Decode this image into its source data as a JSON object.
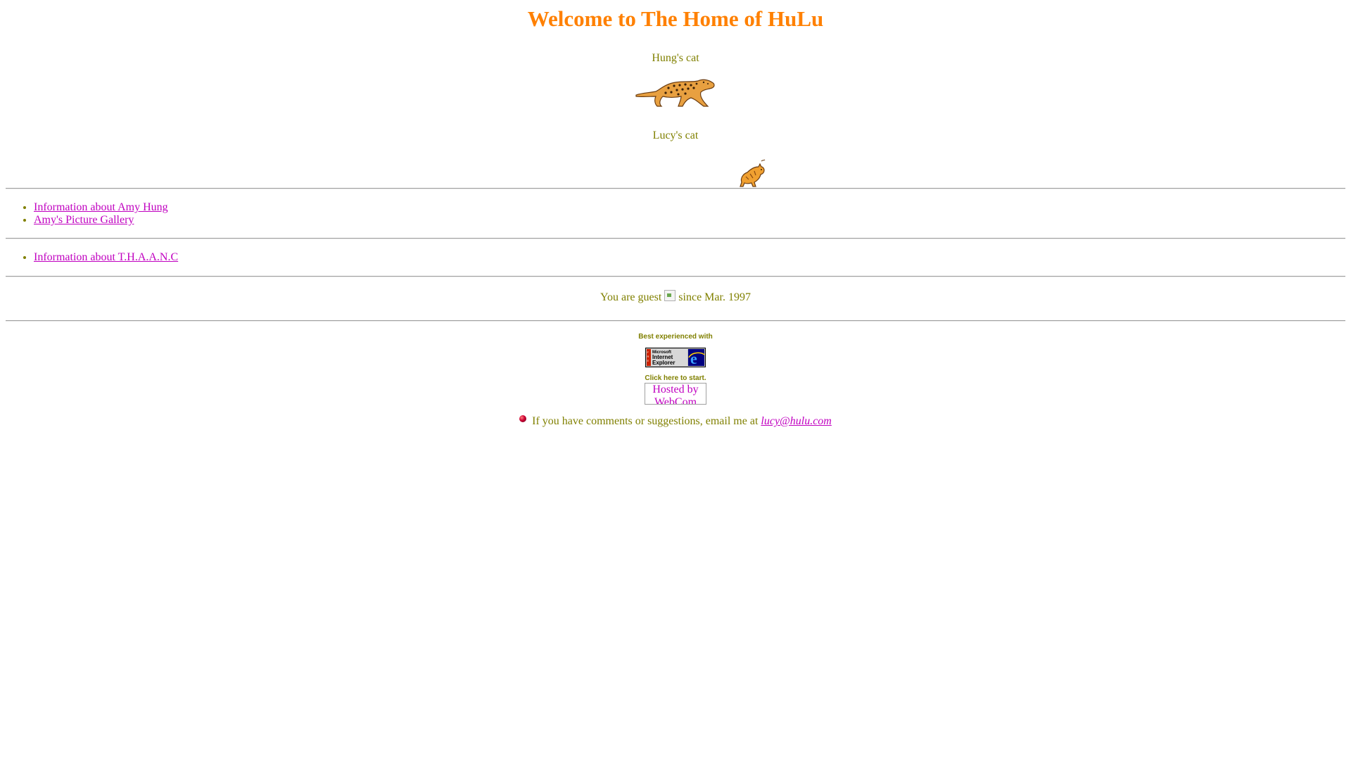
{
  "header": {
    "title": "Welcome to The Home of HuLu"
  },
  "cats": {
    "hung_caption": "Hung's cat",
    "lucy_caption": "Lucy's cat"
  },
  "links_group_1": [
    "Information about Amy Hung",
    "Amy's Picture Gallery"
  ],
  "links_group_2": [
    "Information about T.H.A.A.N.C"
  ],
  "counter": {
    "prefix": "You are guest",
    "suffix": "since Mar. 1997"
  },
  "footer": {
    "best_experienced": "Best experienced with",
    "ie_badge": {
      "line1": "Microsoft",
      "line2": "Internet",
      "line3": "Explorer"
    },
    "click_start": "Click here to start.",
    "hosted_alt": "Hosted by WebCom",
    "comments_text": "If you have comments or suggestions, email me at",
    "email": "lucy@hulu.com"
  },
  "colors": {
    "title": "#ff8000",
    "text": "#808000",
    "link": "#c000c0"
  }
}
